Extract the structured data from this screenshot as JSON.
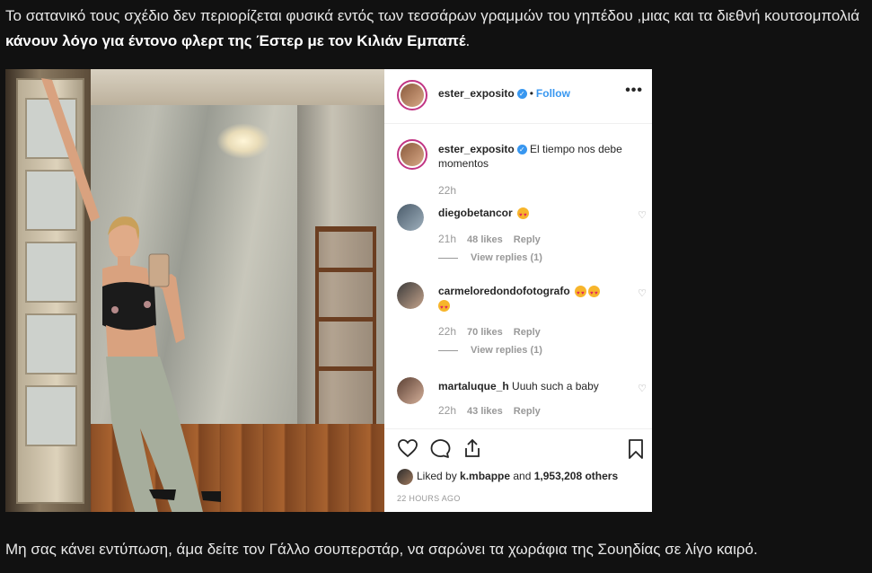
{
  "article": {
    "p1_text": "Το σατανικό τους σχέδιο δεν περιορίζεται φυσικά εντός των τεσσάρων γραμμών του γηπέδου ,μιας και τα διεθνή κουτσομπολιά ",
    "p1_bold": "κάνουν λόγο για έντονο φλερτ της Έστερ με τον Κιλιάν Εμπαπέ",
    "p1_end": ".",
    "p2_text": "Μη σας κάνει εντύπωση, άμα δείτε τον Γάλλο σουπερστάρ, να σαρώνει τα χωράφια της Σουηδίας σε λίγο καιρό."
  },
  "post": {
    "username": "ester_exposito",
    "separator": "•",
    "follow_label": "Follow",
    "more_label": "•••",
    "caption_text": "El tiempo nos debe momentos",
    "caption_time": "22h",
    "comments": [
      {
        "user": "diegobetancor",
        "text": "",
        "emoji_count": 1,
        "time": "21h",
        "likes": "48 likes",
        "reply": "Reply",
        "view_replies": "View replies (1)"
      },
      {
        "user": "carmeloredondofotografo",
        "text": "",
        "emoji_count": 3,
        "time": "22h",
        "likes": "70 likes",
        "reply": "Reply",
        "view_replies": "View replies (1)"
      },
      {
        "user": "martaluque_h",
        "text": "Uuuh such a baby",
        "emoji_count": 0,
        "time": "22h",
        "likes": "43 likes",
        "reply": "Reply",
        "view_replies": ""
      }
    ],
    "liked_by_prefix": "Liked by ",
    "liked_by_user": "k.mbappe",
    "liked_by_mid": " and ",
    "liked_by_count": "1,953,208 others",
    "time_ago": "22 HOURS AGO",
    "icons": [
      "heart-icon",
      "comment-icon",
      "share-icon",
      "bookmark-icon",
      "more-icon",
      "verified-icon"
    ],
    "colors": {
      "link": "#3897f0",
      "text": "#262626",
      "muted": "#999999",
      "ring": "#c13584"
    }
  }
}
